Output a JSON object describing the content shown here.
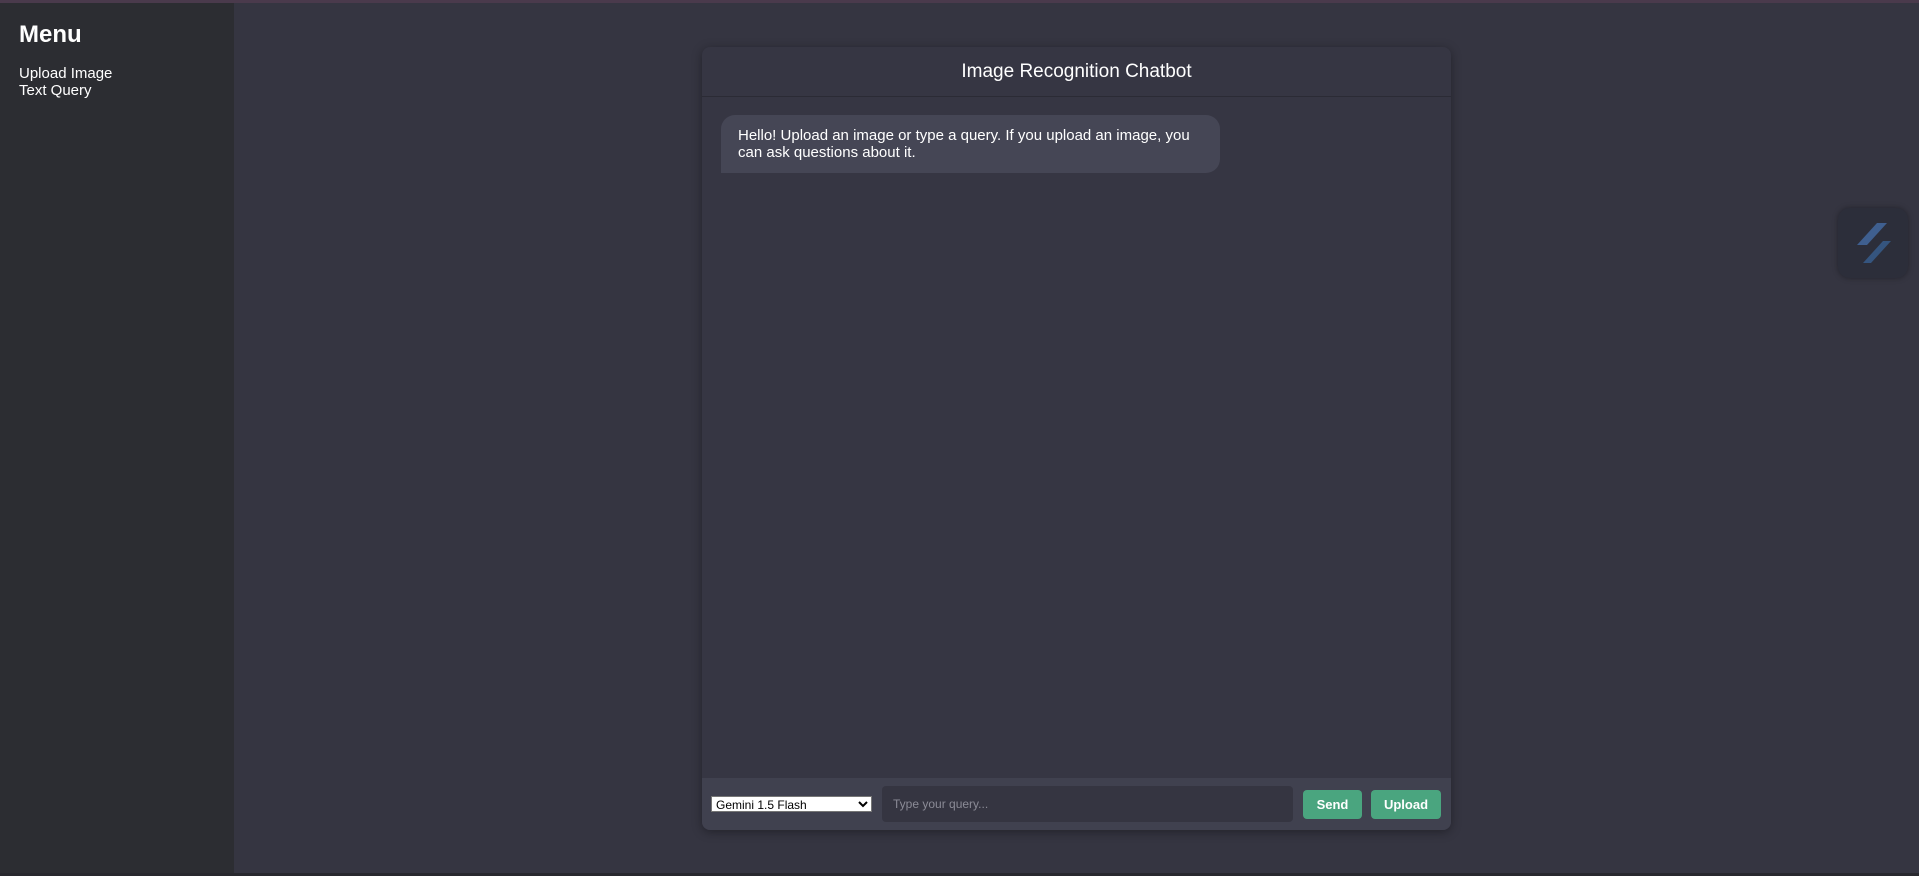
{
  "sidebar": {
    "title": "Menu",
    "items": [
      {
        "label": "Upload Image"
      },
      {
        "label": "Text Query"
      }
    ]
  },
  "chat": {
    "title": "Image Recognition Chatbot",
    "messages": [
      {
        "role": "bot",
        "text": "Hello! Upload an image or type a query. If you upload an image, you can ask questions about it."
      }
    ]
  },
  "input_bar": {
    "model_select": {
      "selected": "Gemini 1.5 Flash"
    },
    "query_placeholder": "Type your query...",
    "send_label": "Send",
    "upload_label": "Upload"
  },
  "extension_widget": {
    "icon": "lightning-stripe-icon"
  },
  "colors": {
    "page_bg": "#353541",
    "sidebar_bg": "#2c2d32",
    "card_bg": "#363643",
    "bubble_bg": "#454655",
    "input_bar_bg": "#40414f",
    "accent_button": "#4aa57f"
  }
}
